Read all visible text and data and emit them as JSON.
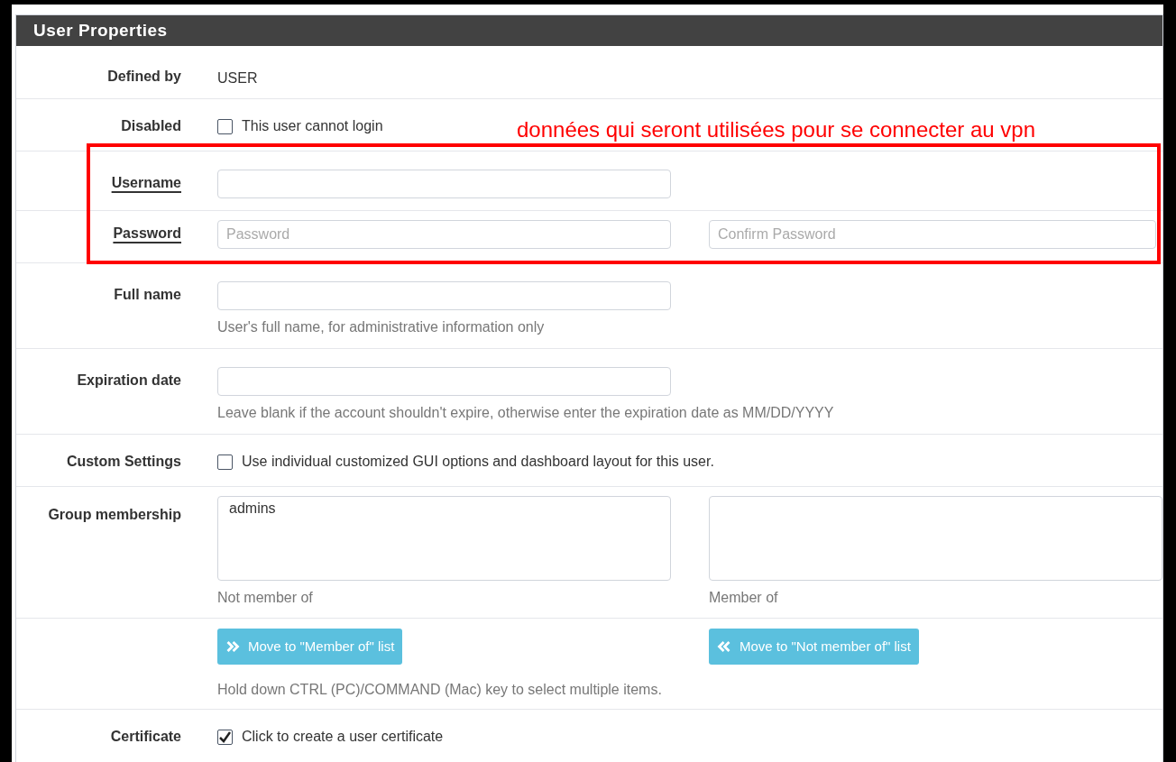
{
  "panel": {
    "title": "User Properties"
  },
  "annotation": {
    "text": "données qui seront utilisées pour se connecter au vpn"
  },
  "rows": [
    {
      "kind": "text",
      "label": "Defined by",
      "required": false,
      "value": "USER"
    },
    {
      "kind": "checkbox",
      "label": "Disabled",
      "required": false,
      "text": "This user cannot login",
      "checked": false
    },
    {
      "kind": "input",
      "label": "Username",
      "required": true
    },
    {
      "kind": "password",
      "label": "Password",
      "required": true,
      "placeholder": "Password",
      "confirm_placeholder": "Confirm Password"
    },
    {
      "kind": "input",
      "label": "Full name",
      "required": false,
      "hint": "User's full name, for administrative information only"
    },
    {
      "kind": "input",
      "label": "Expiration date",
      "required": false,
      "hint": "Leave blank if the account shouldn't expire, otherwise enter the expiration date as MM/DD/YYYY"
    },
    {
      "kind": "checkbox",
      "label": "Custom Settings",
      "required": false,
      "text": "Use individual customized GUI options and dashboard layout for this user.",
      "checked": false
    },
    {
      "kind": "lists",
      "label": "Group membership",
      "required": false,
      "lists": [
        {
          "items": [
            "admins"
          ],
          "caption": "Not member of"
        },
        {
          "caption": "Member of"
        }
      ]
    },
    {
      "kind": "buttons",
      "buttons": [
        {
          "kind": "right",
          "label": "Move to \"Member of\" list"
        },
        {
          "kind": "left",
          "label": "Move to \"Not member of\" list"
        }
      ],
      "hint": "Hold down CTRL (PC)/COMMAND (Mac) key to select multiple items."
    },
    {
      "kind": "checkbox",
      "label": "Certificate",
      "required": false,
      "text": "Click to create a user certificate",
      "checked": true
    }
  ]
}
